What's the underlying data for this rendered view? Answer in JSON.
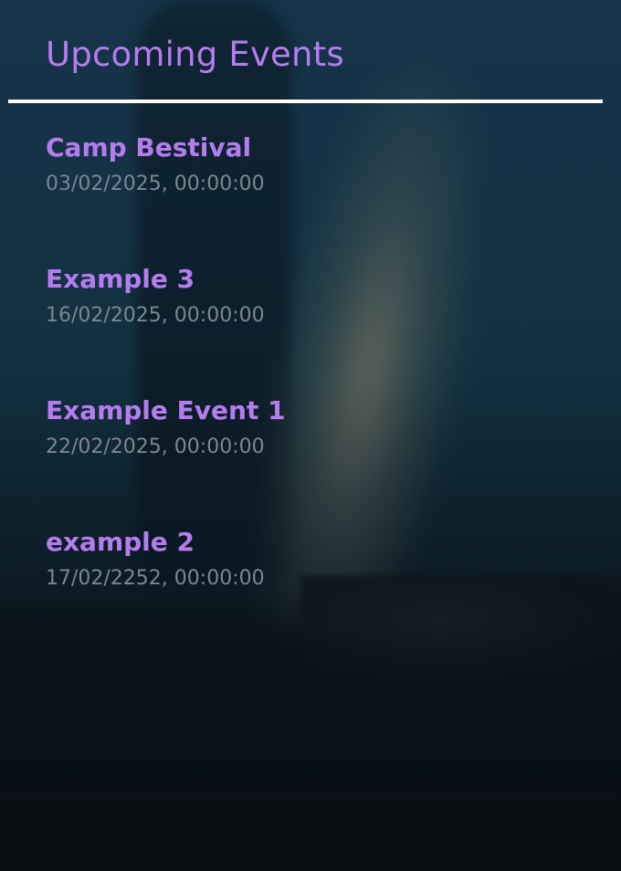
{
  "header": {
    "title": "Upcoming Events"
  },
  "events": [
    {
      "name": "Camp Bestival",
      "date": "03/02/2025, 00:00:00"
    },
    {
      "name": "Example 3",
      "date": "16/02/2025, 00:00:00"
    },
    {
      "name": "Example Event 1",
      "date": "22/02/2025, 00:00:00"
    },
    {
      "name": "example 2",
      "date": "17/02/2252, 00:00:00"
    }
  ],
  "colors": {
    "accent": "#b57cf0",
    "date_text": "#7c8790",
    "divider": "#ffffff",
    "background": "#12303f"
  }
}
